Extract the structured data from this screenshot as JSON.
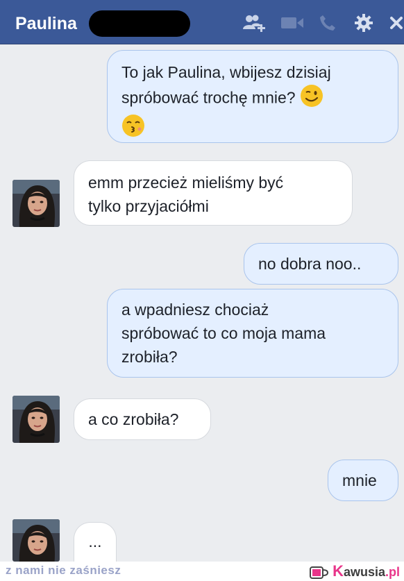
{
  "header": {
    "contact_name": "Paulina",
    "icons": [
      "add-friend-icon",
      "video-call-icon",
      "phone-icon",
      "settings-gear-icon",
      "close-icon"
    ],
    "color": "#3b5998"
  },
  "messages": [
    {
      "side": "out",
      "lines": [
        "To jak Paulina, wbijesz dzisiaj",
        "spróbować trochę mnie?"
      ],
      "emojis": [
        "wink-emoji",
        "kiss-emoji"
      ]
    },
    {
      "side": "in",
      "lines": [
        "emm przecież mieliśmy być",
        "tylko przyjaciółmi"
      ]
    },
    {
      "side": "out",
      "lines": [
        "no dobra noo.."
      ]
    },
    {
      "side": "out",
      "lines": [
        "a wpadniesz chociaż",
        "spróbować to co moja mama",
        "zrobiła?"
      ]
    },
    {
      "side": "in",
      "lines": [
        "a co zrobiła?"
      ]
    },
    {
      "side": "out",
      "lines": [
        "mnie"
      ]
    },
    {
      "side": "in",
      "lines": [
        "..."
      ]
    }
  ],
  "footer": {
    "tagline": "z nami nie zaśniesz",
    "brand_k": "K",
    "brand_rest": "awusia",
    "brand_tld": ".pl"
  }
}
